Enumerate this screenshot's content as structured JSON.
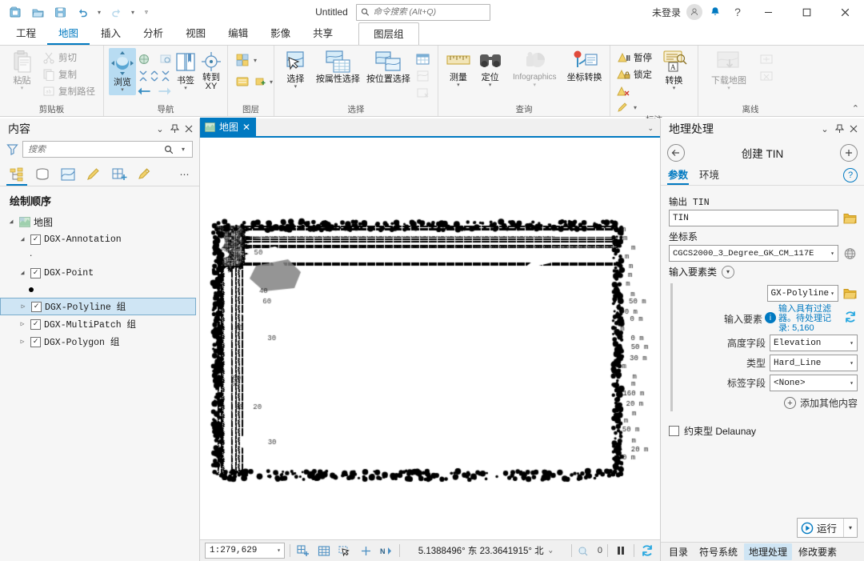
{
  "titlebar": {
    "quick_access": [
      {
        "name": "new-project-icon",
        "label": "新建工程"
      },
      {
        "name": "open-project-icon",
        "label": "打开工程"
      },
      {
        "name": "save-project-icon",
        "label": "保存工程"
      },
      {
        "name": "undo-icon",
        "label": "撤消"
      },
      {
        "name": "redo-icon",
        "label": "恢复"
      },
      {
        "name": "customize-qat-icon",
        "label": "自定义快速访问工具栏"
      }
    ],
    "doc_title": "Untitled",
    "search_placeholder": "命令搜索 (Alt+Q)",
    "sign_in": "未登录",
    "help": "?",
    "minimize": "─",
    "maximize": "☐",
    "close": "✕"
  },
  "ribbon_tabs": [
    {
      "label": "工程",
      "active": false
    },
    {
      "label": "地图",
      "active": true
    },
    {
      "label": "插入",
      "active": false
    },
    {
      "label": "分析",
      "active": false
    },
    {
      "label": "视图",
      "active": false
    },
    {
      "label": "编辑",
      "active": false
    },
    {
      "label": "影像",
      "active": false
    },
    {
      "label": "共享",
      "active": false
    }
  ],
  "contextual_tab": {
    "label": "图层组"
  },
  "ribbon_groups": [
    {
      "name": "clipboard",
      "label": "剪贴板",
      "big": [
        {
          "label": "粘贴",
          "dropdown": true,
          "disabled": true,
          "icon": "paste-icon"
        }
      ],
      "small": [
        {
          "label": "剪切",
          "icon": "cut-icon",
          "disabled": true
        },
        {
          "label": "复制",
          "icon": "copy-icon",
          "disabled": true
        },
        {
          "label": "复制路径",
          "icon": "copy-path-icon",
          "disabled": true
        }
      ],
      "launcher": false
    },
    {
      "name": "navigate",
      "label": "导航",
      "launcher": true
    },
    {
      "name": "layer",
      "label": "图层",
      "launcher": false
    },
    {
      "name": "selection",
      "label": "选择",
      "big": [
        {
          "label": "选择",
          "dropdown": true,
          "icon": "select-icon"
        },
        {
          "label": "按属性选择",
          "dropdown": false,
          "icon": "select-by-attribute-icon"
        },
        {
          "label": "按位置选择",
          "dropdown": false,
          "icon": "select-by-location-icon"
        }
      ],
      "launcher": true
    },
    {
      "name": "inquiry",
      "label": "查询",
      "big": [
        {
          "label": "测量",
          "dropdown": true,
          "icon": "measure-icon"
        },
        {
          "label": "定位",
          "dropdown": true,
          "icon": "locate-icon"
        },
        {
          "label": "Infographics",
          "dropdown": true,
          "icon": "infographics-icon",
          "disabled": true
        },
        {
          "label": "坐标转换",
          "dropdown": false,
          "icon": "coordinate-conversion-icon"
        }
      ],
      "launcher": false
    },
    {
      "name": "labeling",
      "label": "标注",
      "small": [
        {
          "label": "暂停",
          "icon": "pause-labeling-icon"
        },
        {
          "label": "锁定",
          "icon": "lock-labeling-icon"
        }
      ],
      "big": [
        {
          "label": "转换",
          "dropdown": true,
          "icon": "convert-labels-icon"
        }
      ],
      "launcher": true
    },
    {
      "name": "offline",
      "label": "离线",
      "big": [
        {
          "label": "下载地图",
          "dropdown": true,
          "icon": "download-map-icon",
          "disabled": true
        }
      ],
      "launcher": true
    }
  ],
  "navigate_group": {
    "explore_label": "浏览",
    "bookmarks_label": "书签",
    "goto_xy_label": "转到",
    "goto_xy_label2": "XY"
  },
  "contents_pane": {
    "title": "内容",
    "search_placeholder": "搜索",
    "tabs": [
      {
        "name": "list-by-drawing-order-icon",
        "active": true
      },
      {
        "name": "list-by-data-source-icon",
        "active": false
      },
      {
        "name": "list-by-selection-icon",
        "active": false
      },
      {
        "name": "list-by-editing-icon",
        "active": false
      },
      {
        "name": "list-by-snapping-icon",
        "active": false
      },
      {
        "name": "list-by-labeling-icon",
        "active": false
      }
    ],
    "more": "⋯",
    "section_title": "绘制顺序",
    "tree": [
      {
        "label": "地图",
        "level": 0,
        "arrow": "down",
        "checkbox": false,
        "icon": "map-icon",
        "cjk": true,
        "selected": false
      },
      {
        "label": "DGX-Annotation",
        "level": 1,
        "arrow": "down",
        "checkbox": true,
        "checked": true,
        "selected": false,
        "symbol": "annotation"
      },
      {
        "label": "DGX-Point",
        "level": 1,
        "arrow": "down",
        "checkbox": true,
        "checked": true,
        "selected": false,
        "symbol": "point"
      },
      {
        "label": "DGX-Polyline 组",
        "level": 1,
        "arrow": "right",
        "checkbox": true,
        "checked": true,
        "selected": true
      },
      {
        "label": "DGX-MultiPatch 组",
        "level": 1,
        "arrow": "right",
        "checkbox": true,
        "checked": true,
        "selected": false
      },
      {
        "label": "DGX-Polygon 组",
        "level": 1,
        "arrow": "right",
        "checkbox": true,
        "checked": true,
        "selected": false
      }
    ]
  },
  "map_view": {
    "tab_label": "地图",
    "tab_close": "✕"
  },
  "statusbar": {
    "scale": "1:279,629",
    "coordinates": "5.1388496° 东 23.3641915° 北",
    "selection_count": "0",
    "tools": [
      {
        "name": "add-grid-icon"
      },
      {
        "name": "map-grid-icon"
      },
      {
        "name": "selection-tool-icon"
      },
      {
        "name": "crosshair-icon"
      },
      {
        "name": "north-arrow-icon"
      }
    ]
  },
  "geoprocessing": {
    "title": "地理处理",
    "tool_name": "创建 TIN",
    "back_icon": "←",
    "add_icon": "+",
    "tabs": [
      {
        "label": "参数",
        "active": true
      },
      {
        "label": "环境",
        "active": false
      }
    ],
    "help": "?",
    "fields": {
      "output_tin_label": "输出 TIN",
      "output_tin_value": "TIN",
      "coord_system_label": "坐标系",
      "coord_system_value": "CGCS2000_3_Degree_GK_CM_117E",
      "input_feature_class_label": "输入要素类",
      "input_feature_value": "GX-Polyline",
      "input_features_label": "输入要素",
      "info_text": "输入具有过滤器。待处理记录: 5,160",
      "height_field_label": "高度字段",
      "height_field_value": "Elevation",
      "type_label": "类型",
      "type_value": "Hard_Line",
      "tag_field_label": "标签字段",
      "tag_field_value": "<None>",
      "add_more_label": "添加其他内容",
      "delaunay_label": "约束型 Delaunay",
      "delaunay_checked": false
    },
    "run_label": "运行",
    "bottom_tabs": [
      {
        "label": "目录",
        "active": false
      },
      {
        "label": "符号系统",
        "active": false
      },
      {
        "label": "地理处理",
        "active": true
      },
      {
        "label": "修改要素",
        "active": false
      }
    ]
  },
  "colors": {
    "accent": "#0079c1",
    "ribbon_bg": "#f6f6f6",
    "selected_row": "#cfe5f4",
    "map_bg": "#ffffff",
    "map_data": "#000000"
  },
  "map_labels": [
    "m",
    "m",
    "m",
    "m",
    "m",
    "m",
    "m",
    "m",
    "50 m",
    "70 m",
    "0 m",
    "m",
    "0 m",
    "50 m",
    "30 m",
    "m",
    "m",
    "m",
    "160 m",
    "20 m",
    "m",
    "m",
    "50 m",
    "m",
    "20 m",
    "0 m"
  ]
}
